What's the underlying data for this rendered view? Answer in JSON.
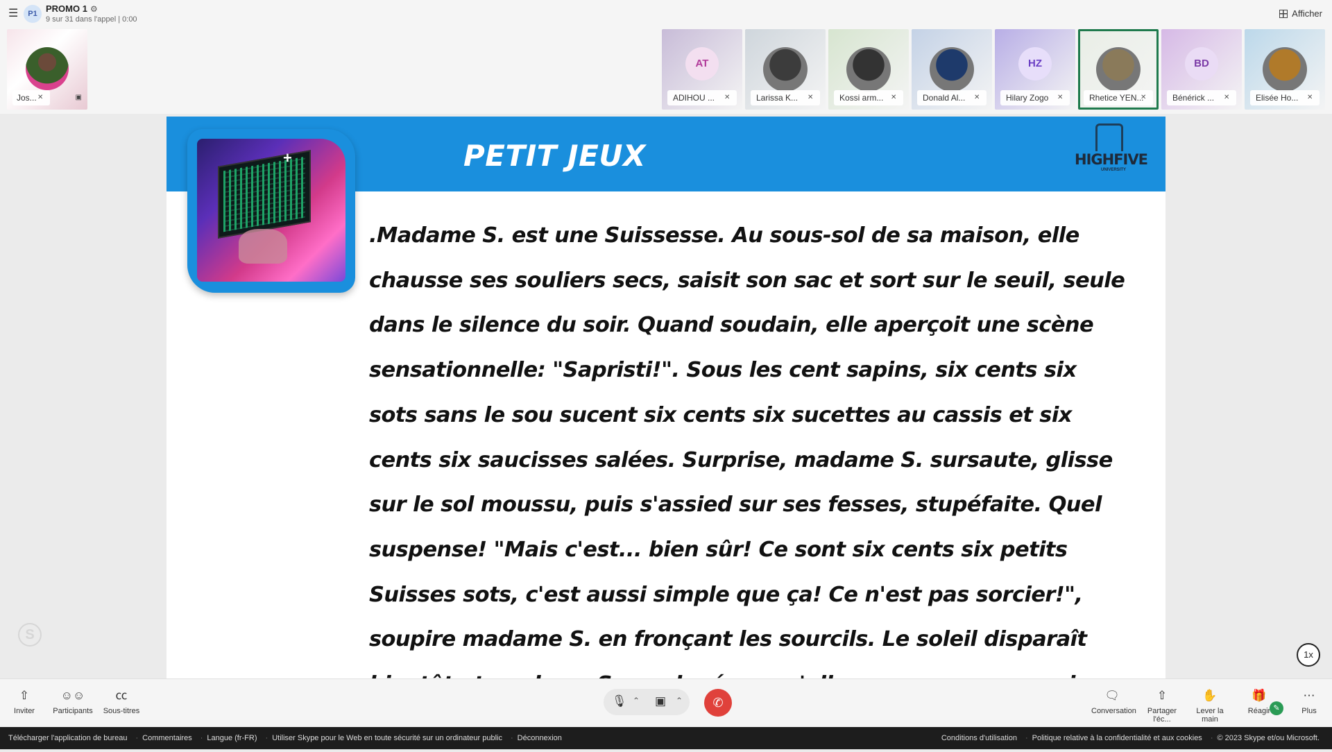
{
  "header": {
    "call_avatar": "P1",
    "call_title": "PROMO 1",
    "call_subtitle": "9 sur 31 dans l'appel | 0:00",
    "view_button": "Afficher"
  },
  "self_tile": {
    "label": "Jos..."
  },
  "participants": [
    {
      "label": "ADIHOU ...",
      "initials": "AT",
      "bg": "#c8bcd8",
      "ini_bg": "#f3dff0",
      "ini_color": "#b13a9a"
    },
    {
      "label": "Larissa K...",
      "initials": "",
      "bg": "#cfd6dc",
      "ph": "#3c3c3c"
    },
    {
      "label": "Kossi arm...",
      "initials": "",
      "bg": "#d7e5d0",
      "ph": "#333"
    },
    {
      "label": "Donald Al...",
      "initials": "",
      "bg": "#c4d2e6",
      "ph": "#1e3a6b"
    },
    {
      "label": "Hilary Zogo",
      "initials": "HZ",
      "bg": "#b8aee6",
      "ini_bg": "#e7defa",
      "ini_color": "#6a3ec4"
    },
    {
      "label": "Rhetice YEN...",
      "initials": "",
      "bg": "#e9eee6",
      "ph": "#8a7a5a",
      "active": true
    },
    {
      "label": "Bénérick ...",
      "initials": "BD",
      "bg": "#d6b9e6",
      "ini_bg": "#eadcf5",
      "ini_color": "#7b3aa6"
    },
    {
      "label": "Elisée Ho...",
      "initials": "",
      "bg": "#bcd8ea",
      "ph": "#b07a2a"
    }
  ],
  "slide": {
    "title": "PETIT JEUX",
    "logo_text": "HIGHFIVE",
    "logo_sub": "UNIVERSITY",
    "body": ".Madame S. est une Suissesse. Au sous-sol de sa maison, elle chausse ses souliers secs, saisit son sac et sort sur le seuil, seule dans le silence du soir. Quand soudain, elle aperçoit une scène sensationnelle: \"Sapristi!\". Sous les cent sapins, six cents six sots sans le sou sucent six cents six sucettes au cassis et six cents six saucisses salées. Surprise, madame S. sursaute, glisse sur le sol moussu, puis s'assied sur ses fesses, stupéfaite. Quel suspense! \"Mais c'est... bien sûr! Ce sont six cents six petits Suisses sots, c'est aussi simple que ça! Ce n'est pas sorcier!\", soupire madame S. en fronçant les sourcils. Le soleil disparaît bientôt et madame S., soulagée, va s'allonger sur son sommier, sans souci.",
    "speed": "1x"
  },
  "toolbar": {
    "invite": "Inviter",
    "participants": "Participants",
    "captions": "Sous-titres",
    "conversation": "Conversation",
    "share": "Partager l'éc...",
    "raise_hand": "Lever la main",
    "react": "Réagir",
    "more": "Plus"
  },
  "footer": {
    "left": [
      "Télécharger l'application de bureau",
      "Commentaires",
      "Langue (fr-FR)",
      "Utiliser Skype pour le Web en toute sécurité sur un ordinateur public",
      "Déconnexion"
    ],
    "right": [
      "Conditions d'utilisation",
      "Politique relative à la confidentialité et aux cookies",
      "© 2023 Skype et/ou Microsoft."
    ]
  },
  "colors": {
    "banner": "#1a8fdd",
    "hangup": "#e0413b",
    "active_tile": "#1f7a4d"
  }
}
